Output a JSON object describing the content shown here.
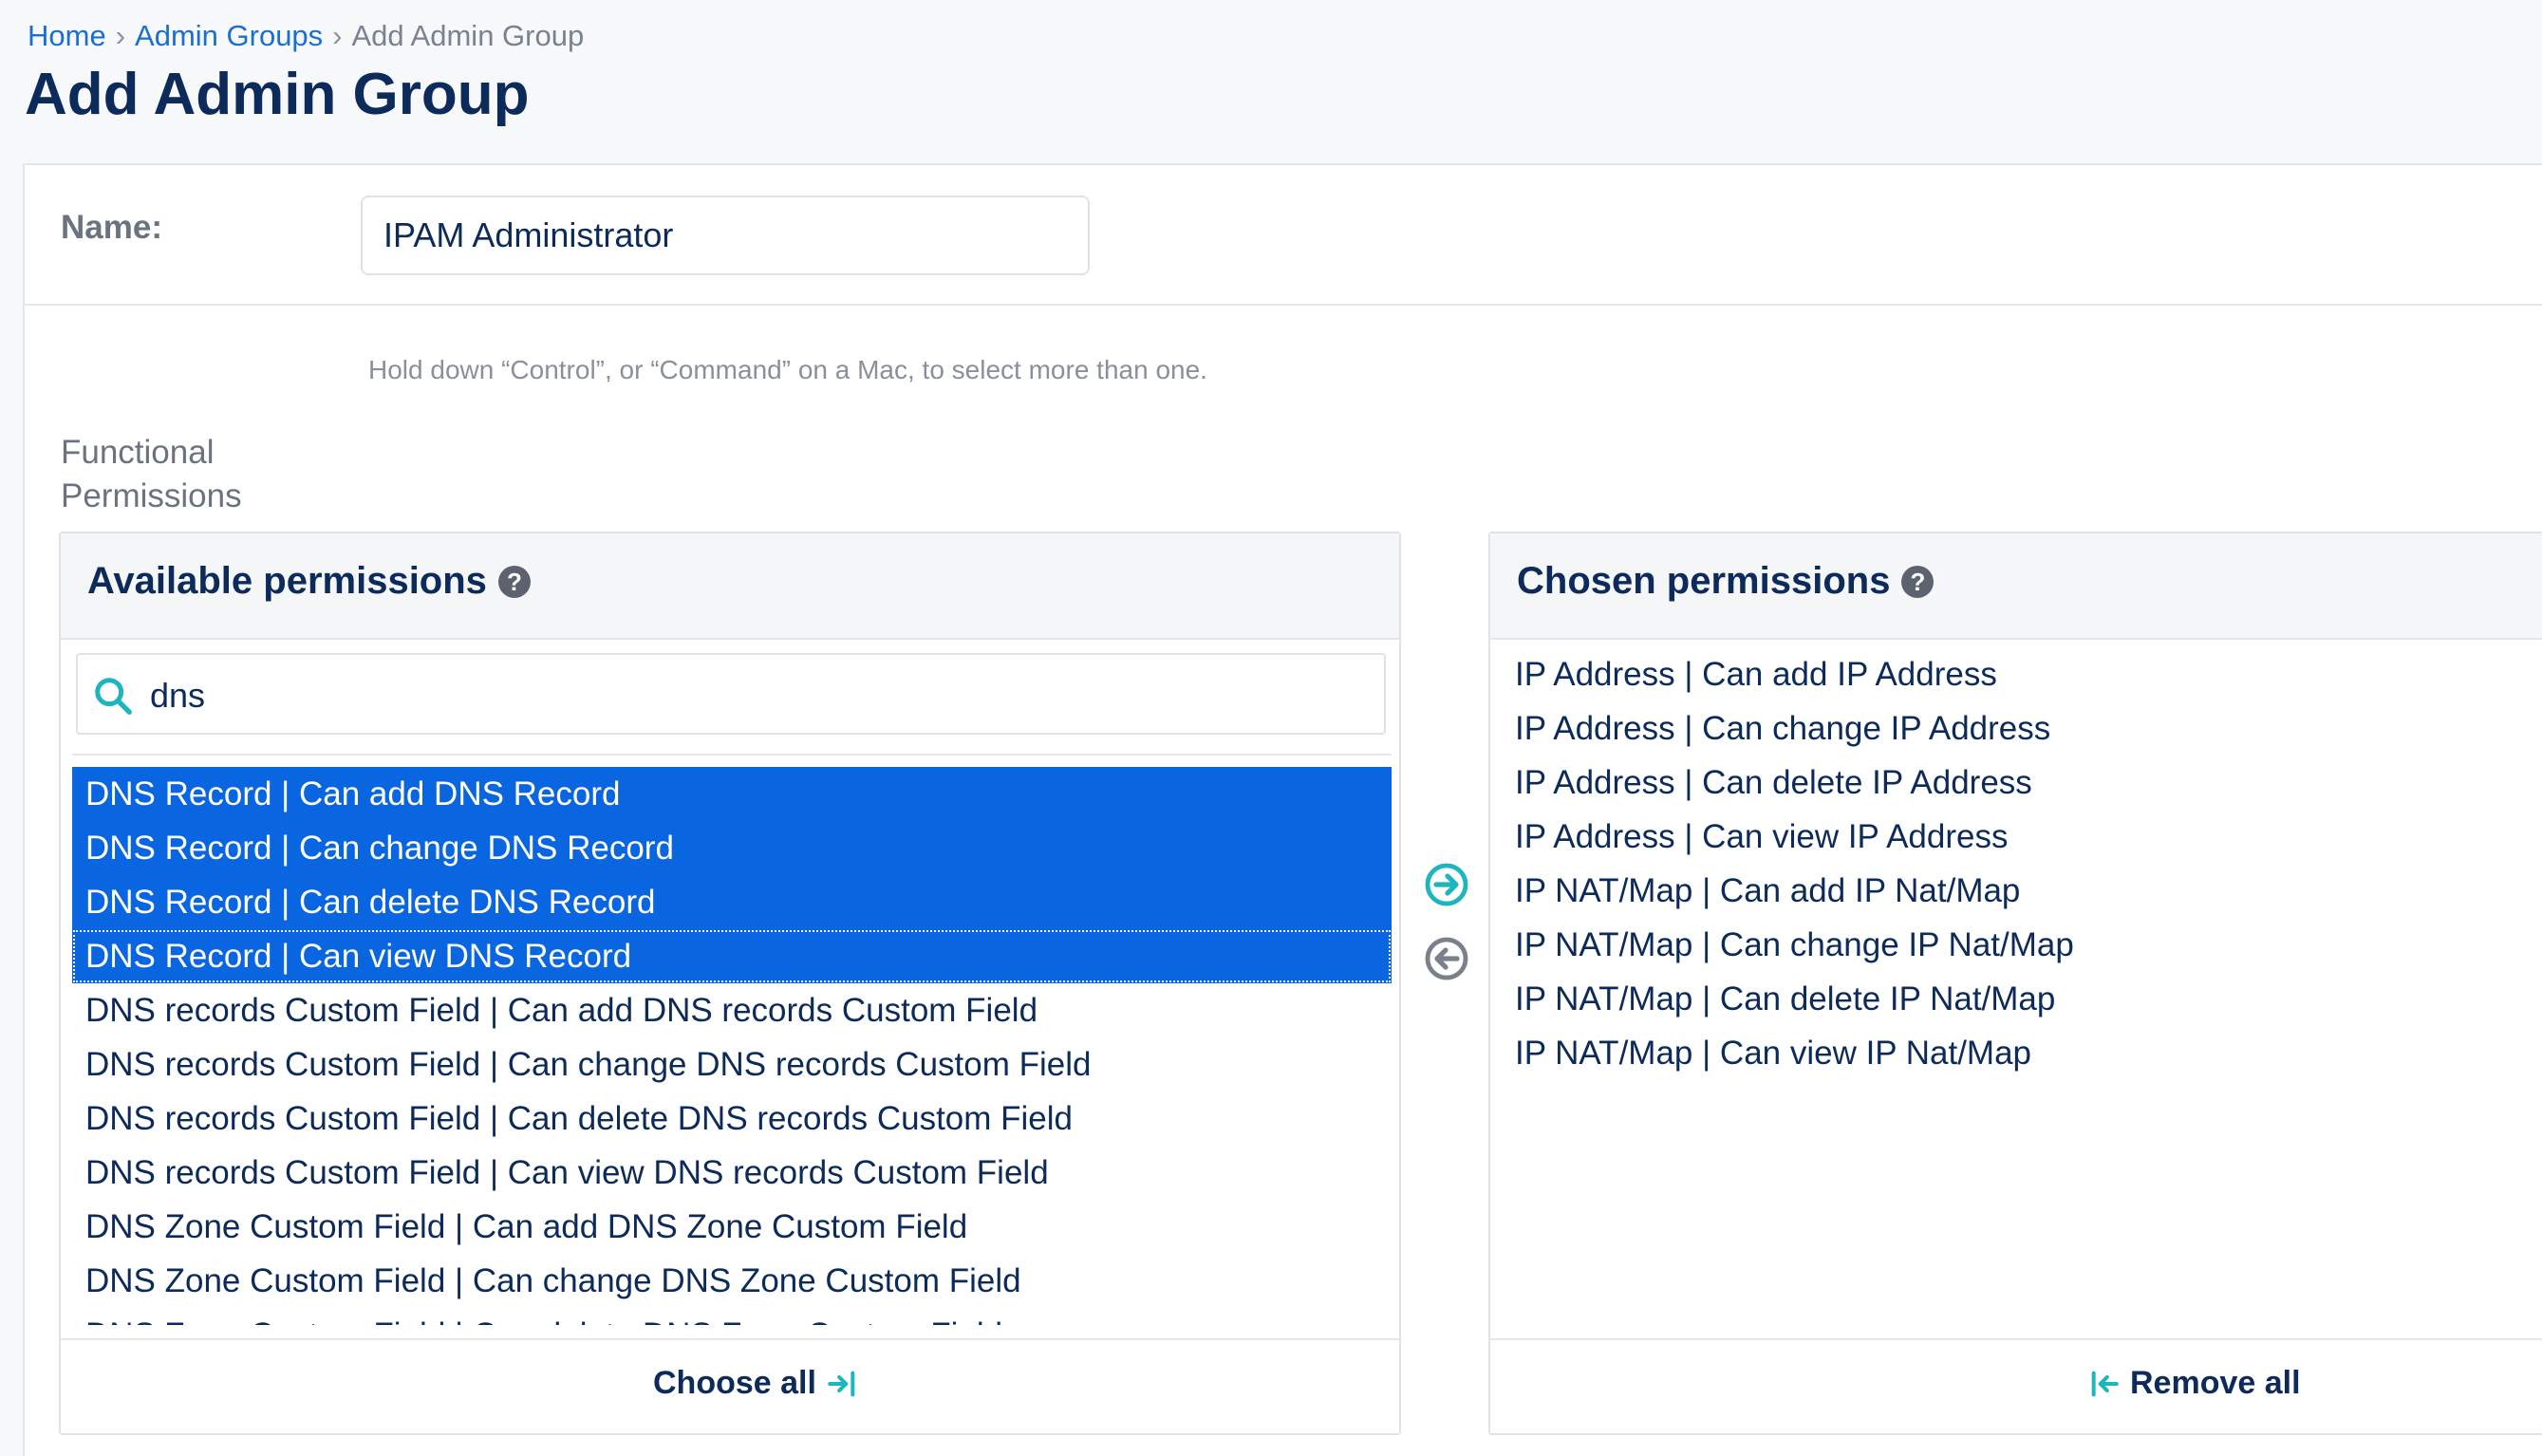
{
  "breadcrumb": {
    "home": "Home",
    "separator": "›",
    "admin_groups": "Admin Groups",
    "current": "Add Admin Group"
  },
  "page": {
    "title": "Add Admin Group"
  },
  "form": {
    "name_label": "Name:",
    "name_value": "IPAM Administrator",
    "help_text": "Hold down “Control”, or “Command” on a Mac, to select more than one.",
    "functional_permissions_label": "Functional Permissions"
  },
  "available": {
    "title": "Available permissions",
    "help_icon": "?",
    "filter_value": "dns",
    "options": [
      "DNS Record | Can add DNS Record",
      "DNS Record | Can change DNS Record",
      "DNS Record | Can delete DNS Record",
      "DNS Record | Can view DNS Record",
      "DNS records Custom Field | Can add DNS records Custom Field",
      "DNS records Custom Field | Can change DNS records Custom Field",
      "DNS records Custom Field | Can delete DNS records Custom Field",
      "DNS records Custom Field | Can view DNS records Custom Field",
      "DNS Zone Custom Field | Can add DNS Zone Custom Field",
      "DNS Zone Custom Field | Can change DNS Zone Custom Field",
      "DNS Zone Custom Field | Can delete DNS Zone Custom Field"
    ],
    "choose_all_label": "Choose all"
  },
  "chosen": {
    "title": "Chosen permissions",
    "help_icon": "?",
    "options": [
      "IP Address | Can add IP Address",
      "IP Address | Can change IP Address",
      "IP Address | Can delete IP Address",
      "IP Address | Can view IP Address",
      "IP NAT/Map | Can add IP Nat/Map",
      "IP NAT/Map | Can change IP Nat/Map",
      "IP NAT/Map | Can delete IP Nat/Map",
      "IP NAT/Map | Can view IP Nat/Map"
    ],
    "remove_all_label": "Remove all"
  },
  "icons": {
    "search": "search-icon",
    "add_arrow": "arrow-right-circle-icon",
    "remove_arrow": "arrow-left-circle-icon",
    "choose_all": "arrow-right-to-bar-icon",
    "remove_all": "arrow-left-to-bar-icon"
  },
  "colors": {
    "accent_teal": "#1fb5bf",
    "selected_bg": "#0a66e0",
    "link": "#1a6fd1",
    "title": "#0c2a5a"
  }
}
